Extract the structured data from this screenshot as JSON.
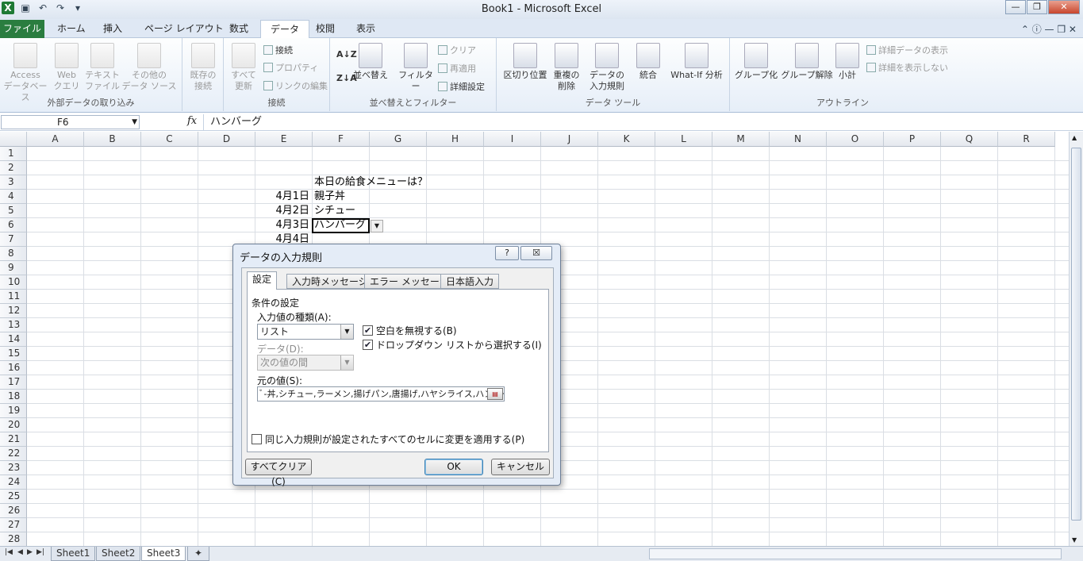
{
  "window": {
    "title": "Book1 - Microsoft Excel"
  },
  "tabs": [
    "ファイル",
    "ホーム",
    "挿入",
    "ページ レイアウト",
    "数式",
    "データ",
    "校閲",
    "表示"
  ],
  "ribbon": {
    "ext": {
      "label": "外部データの取り込み",
      "access": "Access",
      "access2": "データベース",
      "web": "Web",
      "web2": "クエリ",
      "text": "テキスト",
      "text2": "ファイル",
      "other": "その他の",
      "other2": "データ ソース",
      "existing": "既存の",
      "existing2": "接続"
    },
    "conn": {
      "label": "接続",
      "refresh": "すべて",
      "refresh2": "更新",
      "connections": "接続",
      "properties": "プロパティ",
      "editlinks": "リンクの編集"
    },
    "sort": {
      "label": "並べ替えとフィルター",
      "sort": "並べ替え",
      "filter": "フィルター",
      "clear": "クリア",
      "reapply": "再適用",
      "advanced": "詳細設定"
    },
    "tools": {
      "label": "データ ツール",
      "text_to_cols": "区切り位置",
      "dup": "重複の",
      "dup2": "削除",
      "validation": "データの",
      "validation2": "入力規則",
      "consolidate": "統合",
      "whatif": "What-If 分析"
    },
    "outline": {
      "label": "アウトライン",
      "group": "グループ化",
      "ungroup": "グループ解除",
      "subtotal": "小計",
      "show": "詳細データの表示",
      "hide": "詳細を表示しない"
    }
  },
  "formula": {
    "namebox": "F6",
    "fx": "fx",
    "content": "ハンバーグ"
  },
  "columns": [
    "A",
    "B",
    "C",
    "D",
    "E",
    "F",
    "G",
    "H",
    "I",
    "J",
    "K",
    "L",
    "M",
    "N",
    "O",
    "P",
    "Q",
    "R"
  ],
  "rows": [
    "1",
    "2",
    "3",
    "4",
    "5",
    "6",
    "7",
    "8",
    "9",
    "10",
    "11",
    "12",
    "13",
    "14",
    "15",
    "16",
    "17",
    "18",
    "19",
    "20",
    "21",
    "22",
    "23",
    "24",
    "25",
    "26",
    "27",
    "28"
  ],
  "cells": {
    "f3": "本日の給食メニューは？",
    "e4": "4月1日",
    "f4": "親子丼",
    "e5": "4月2日",
    "f5": "シチュー",
    "e6": "4月3日",
    "f6": "ハンバーグ",
    "e7": "4月4日"
  },
  "sheets": [
    "Sheet1",
    "Sheet2",
    "Sheet3"
  ],
  "dialog": {
    "title": "データの入力規則",
    "help": "?",
    "close": "☒",
    "tabs": [
      "設定",
      "入力時メッセージ",
      "エラー メッセージ",
      "日本語入力"
    ],
    "section": "条件の設定",
    "allow_label": "入力値の種類(A):",
    "allow_value": "リスト",
    "ignore_blank": "空白を無視する(B)",
    "dropdown": "ドロップダウン リストから選択する(I)",
    "data_label": "データ(D):",
    "data_value": "次の値の間",
    "source_label": "元の値(S):",
    "source_value": "ﾞ-丼,シチュー,ラーメン,揚げパン,唐揚げ,ハヤシライス,ハンバーグ",
    "apply_all": "同じ入力規則が設定されたすべてのセルに変更を適用する(P)",
    "clear_all": "すべてクリア(C)",
    "ok": "OK",
    "cancel": "キャンセル"
  }
}
